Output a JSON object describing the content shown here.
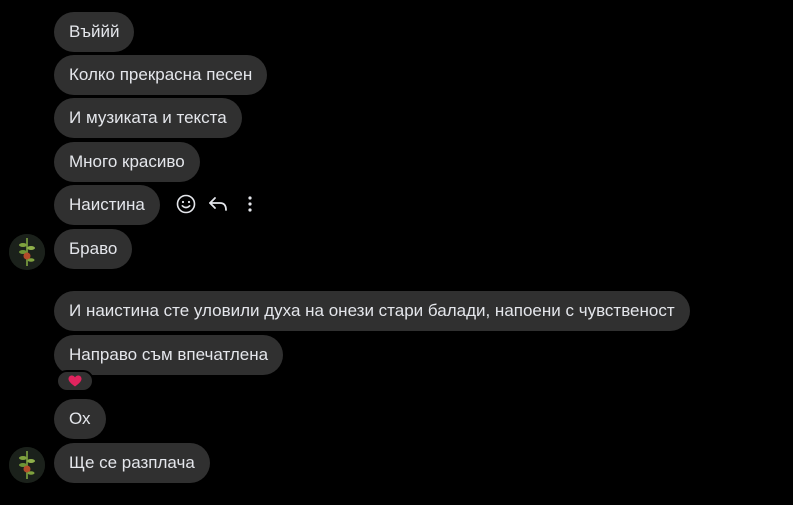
{
  "messages": [
    {
      "text": "Въййй"
    },
    {
      "text": "Колко прекрасна песен"
    },
    {
      "text": "И музиката и текста"
    },
    {
      "text": "Много красиво"
    },
    {
      "text": "Наистина"
    },
    {
      "text": "Браво"
    },
    {
      "text": "И наистина сте уловили духа на онези стари балади, напоени с чувственост"
    },
    {
      "text": "Направо съм впечатлена"
    },
    {
      "text": "Ох"
    },
    {
      "text": "Ще се разплача"
    }
  ],
  "message_actions": [
    "smiley-icon",
    "reply-icon",
    "more-vertical-icon"
  ],
  "reaction": {
    "icon": "heart-icon",
    "color": "#e0245e"
  },
  "colors": {
    "background": "#000000",
    "bubble": "#303030",
    "text": "#e4e6eb",
    "icon": "#e4e6eb"
  }
}
